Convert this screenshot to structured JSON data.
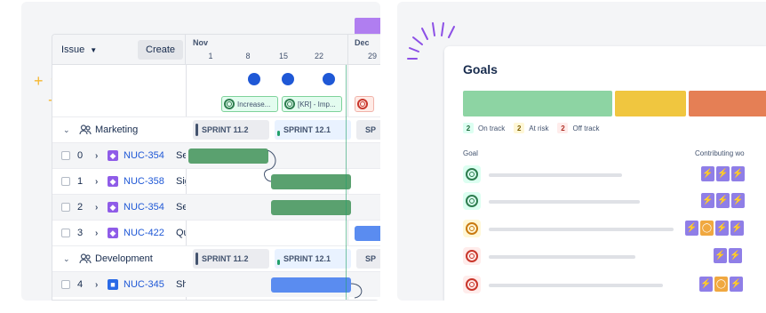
{
  "roadmap": {
    "issue_dropdown_label": "Issue",
    "create_button": "Create",
    "months": [
      {
        "label": "Nov"
      },
      {
        "label": "Dec"
      }
    ],
    "days": [
      "1",
      "8",
      "15",
      "22",
      "29"
    ],
    "goal_chips": [
      {
        "label": "Increase..."
      },
      {
        "label": "[KR] - Imp..."
      },
      {
        "label": ""
      }
    ],
    "groups": [
      {
        "label": "Marketing",
        "sprints": [
          "SPRINT 11.2",
          "SPRINT 12.1",
          "SP"
        ],
        "issues": [
          {
            "num": "0",
            "key": "NUC-354",
            "summary": "Se"
          },
          {
            "num": "1",
            "key": "NUC-358",
            "summary": "Sig"
          },
          {
            "num": "2",
            "key": "NUC-354",
            "summary": "Se"
          },
          {
            "num": "3",
            "key": "NUC-422",
            "summary": "Qu"
          }
        ]
      },
      {
        "label": "Development",
        "sprints": [
          "SPRINT 11.2",
          "SPRINT 12.1",
          "SP"
        ],
        "issues": [
          {
            "num": "4",
            "key": "NUC-345",
            "summary": "Sh"
          }
        ]
      }
    ]
  },
  "goals": {
    "title": "Goals",
    "legend": [
      {
        "count": "2",
        "label": "On track",
        "color": "#8dd4a3",
        "text_color": "#1f6b3b"
      },
      {
        "count": "2",
        "label": "At risk",
        "color": "#f5cd47",
        "text_color": "#7f5f01"
      },
      {
        "count": "2",
        "label": "Off track",
        "color": "#f8a88c",
        "text_color": "#ae2e24"
      }
    ],
    "column_goal": "Goal",
    "column_contributing": "Contributing wo",
    "rows": [
      {
        "status": "on-track"
      },
      {
        "status": "on-track"
      },
      {
        "status": "at-risk"
      },
      {
        "status": "off-track"
      },
      {
        "status": "off-track"
      }
    ]
  }
}
